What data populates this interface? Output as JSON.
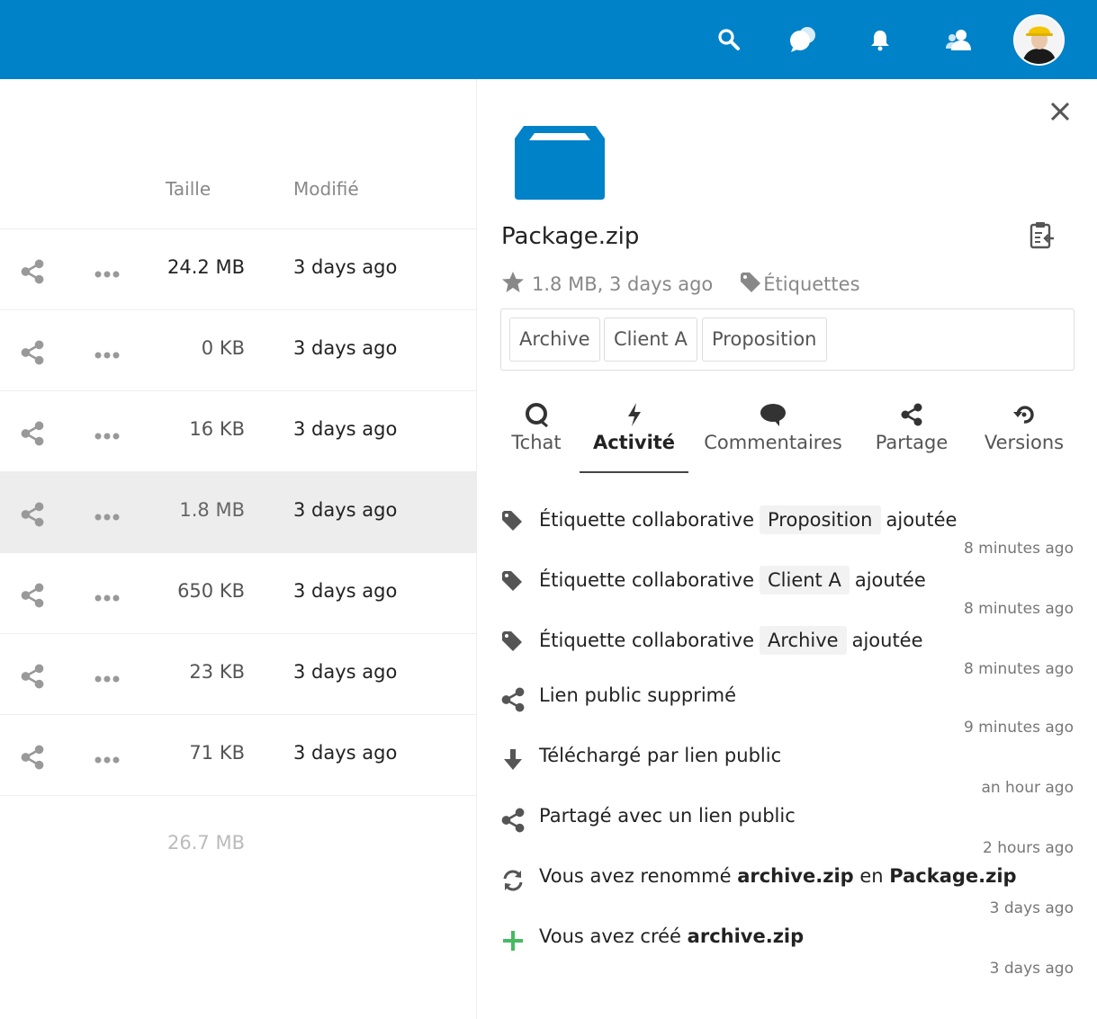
{
  "header": {
    "icons": [
      "search-icon",
      "talk-icon",
      "notifications-icon",
      "contacts-icon"
    ],
    "accent": "#0082c9"
  },
  "files": {
    "col_size": "Taille",
    "col_modified": "Modifié",
    "rows": [
      {
        "size": "24.2 MB",
        "modified": "3 days ago",
        "selected": false,
        "size_color": "#222"
      },
      {
        "size": "0 KB",
        "modified": "3 days ago",
        "selected": false,
        "size_color": "#555"
      },
      {
        "size": "16 KB",
        "modified": "3 days ago",
        "selected": false,
        "size_color": "#555"
      },
      {
        "size": "1.8 MB",
        "modified": "3 days ago",
        "selected": true,
        "size_color": "#666"
      },
      {
        "size": "650 KB",
        "modified": "3 days ago",
        "selected": false,
        "size_color": "#555"
      },
      {
        "size": "23 KB",
        "modified": "3 days ago",
        "selected": false,
        "size_color": "#555"
      },
      {
        "size": "71 KB",
        "modified": "3 days ago",
        "selected": false,
        "size_color": "#555"
      }
    ],
    "total": "26.7 MB"
  },
  "sidebar": {
    "filename": "Package.zip",
    "meta": "1.8 MB, 3 days ago",
    "tags_label": "Étiquettes",
    "tags": [
      "Archive",
      "Client A",
      "Proposition"
    ],
    "tabs": [
      {
        "label": "Tchat",
        "icon": "talk-icon",
        "active": false
      },
      {
        "label": "Activité",
        "icon": "activity-icon",
        "active": true
      },
      {
        "label": "Commentaires",
        "icon": "comment-icon",
        "active": false
      },
      {
        "label": "Partage",
        "icon": "share-icon",
        "active": false
      },
      {
        "label": "Versions",
        "icon": "history-icon",
        "active": false
      }
    ],
    "activities": [
      {
        "icon": "tag-icon",
        "parts": [
          [
            "t",
            "Étiquette collaborative"
          ],
          [
            "pill",
            "Proposition"
          ],
          [
            "t",
            "ajoutée"
          ]
        ],
        "time": "8 minutes ago"
      },
      {
        "icon": "tag-icon",
        "parts": [
          [
            "t",
            "Étiquette collaborative"
          ],
          [
            "pill",
            "Client A"
          ],
          [
            "t",
            "ajoutée"
          ]
        ],
        "time": "8 minutes ago"
      },
      {
        "icon": "tag-icon",
        "parts": [
          [
            "t",
            "Étiquette collaborative"
          ],
          [
            "pill",
            "Archive"
          ],
          [
            "t",
            "ajoutée"
          ]
        ],
        "time": "8 minutes ago"
      },
      {
        "icon": "share-icon",
        "parts": [
          [
            "t",
            "Lien public supprimé"
          ]
        ],
        "time": "9 minutes ago"
      },
      {
        "icon": "download-icon",
        "parts": [
          [
            "t",
            "Téléchargé par lien public"
          ]
        ],
        "time": "an hour ago"
      },
      {
        "icon": "share-icon",
        "parts": [
          [
            "t",
            "Partagé avec un lien public"
          ]
        ],
        "time": "2 hours ago"
      },
      {
        "icon": "rename-icon",
        "parts": [
          [
            "t",
            "Vous avez renommé "
          ],
          [
            "b",
            "archive.zip"
          ],
          [
            "t",
            " en "
          ],
          [
            "b",
            "Package.zip"
          ]
        ],
        "time": "3 days ago"
      },
      {
        "icon": "add-icon",
        "parts": [
          [
            "t",
            "Vous avez créé "
          ],
          [
            "b",
            "archive.zip"
          ]
        ],
        "time": "3 days ago"
      }
    ]
  }
}
